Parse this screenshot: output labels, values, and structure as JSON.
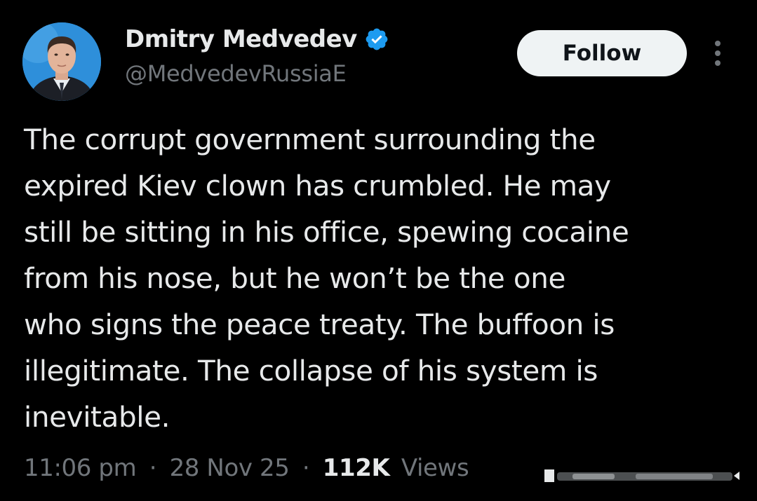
{
  "user": {
    "display_name": "Dmitry Medvedev",
    "handle": "@MedvedevRussiaE",
    "avatar_icon": "profile-photo",
    "verified_icon": "verified-badge-icon",
    "verified_color": "#1d9bf0"
  },
  "actions": {
    "follow_label": "Follow",
    "more_icon": "more-vertical-icon"
  },
  "tweet": {
    "lines": [
      "The corrupt government surrounding the",
      "expired Kiev clown has crumbled. He may",
      "still be sitting in his office, spewing cocaine",
      "from his nose, but he won’t be the one",
      "who signs the peace treaty. The buffoon is",
      "illegitimate. The collapse of his system is",
      "inevitable."
    ]
  },
  "meta": {
    "time": "11:06 pm",
    "separator": "·",
    "date": "28 Nov 25",
    "views_count": "112K",
    "views_label": "Views"
  },
  "colors": {
    "background": "#000000",
    "primary_text": "#e7e9ea",
    "secondary_text": "#71767b",
    "follow_bg": "#eff3f4",
    "follow_text": "#0f1419"
  }
}
